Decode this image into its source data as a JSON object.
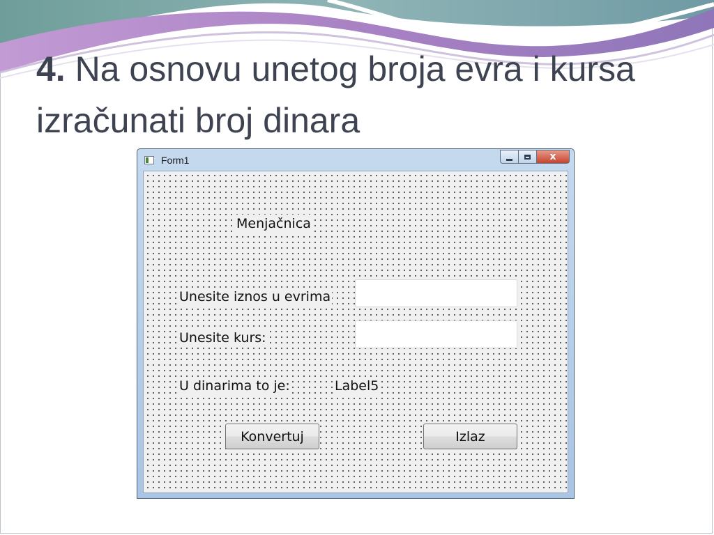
{
  "slide": {
    "title_number": "4.",
    "title_text": " Na osnovu unetog broja evra i kursa izračunati broj dinara"
  },
  "window": {
    "title": "Form1",
    "close_glyph": "x"
  },
  "form": {
    "heading": "Menjačnica",
    "euro_label": "Unesite iznos u evrima",
    "euro_value": "",
    "rate_label": "Unesite kurs:",
    "rate_value": "",
    "result_label": "U dinarima to je:",
    "result_value": "Label5",
    "convert_button": "Konvertuj",
    "exit_button": "Izlaz"
  },
  "colors": {
    "title_text": "#3e4351",
    "swoosh_purple": "#a77fc2",
    "swoosh_teal": "#7fa9a8",
    "close_button": "#c4442e"
  }
}
